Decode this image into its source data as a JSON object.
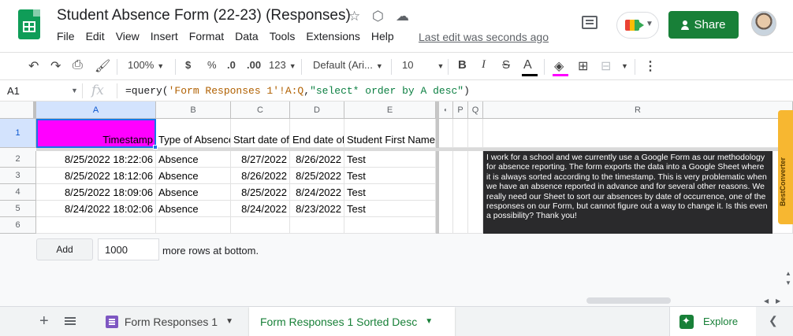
{
  "header": {
    "title": "Student Absence Form (22-23) (Responses)",
    "menu": [
      "File",
      "Edit",
      "View",
      "Insert",
      "Format",
      "Data",
      "Tools",
      "Extensions",
      "Help"
    ],
    "last_edit": "Last edit was seconds ago",
    "share_label": "Share"
  },
  "toolbar": {
    "zoom": "100%",
    "currency": "$",
    "percent": "%",
    "decrease_decimal": ".0",
    "increase_decimal": ".00",
    "more_formats": "123",
    "font": "Default (Ari...",
    "font_size": "10",
    "bold": "B",
    "italic": "I",
    "strike": "S",
    "text_color": "A",
    "fill_color": "#ff00ff",
    "text_color_bar": "#000000"
  },
  "formula_bar": {
    "cell_ref": "A1",
    "fx": "fx",
    "formula_fn": "=query(",
    "formula_arg1": "'Form Responses 1'!A:Q",
    "formula_comma": ",",
    "formula_arg2": "\"select* order by A desc\"",
    "formula_close": ")"
  },
  "grid": {
    "columns": [
      "A",
      "B",
      "C",
      "D",
      "E",
      "",
      "P",
      "Q",
      "R"
    ],
    "rows": [
      "1",
      "2",
      "3",
      "4",
      "5",
      "6"
    ],
    "header_row": [
      "Timestamp",
      "Type of Absence",
      "Start date of",
      "End date of",
      "Student First Name"
    ],
    "data_rows": [
      [
        "8/25/2022 18:22:06",
        "Absence",
        "8/27/2022",
        "8/26/2022",
        "Test"
      ],
      [
        "8/25/2022 18:12:06",
        "Absence",
        "8/26/2022",
        "8/25/2022",
        "Test"
      ],
      [
        "8/25/2022 18:09:06",
        "Absence",
        "8/25/2022",
        "8/24/2022",
        "Test"
      ],
      [
        "8/24/2022 18:02:06",
        "Absence",
        "8/24/2022",
        "8/23/2022",
        "Test"
      ]
    ],
    "a1_fill": "#ff00ff"
  },
  "note": "I work for a school and we currently use a Google Form as our methodology for absence reporting. The form exports the data into a Google Sheet where it is always sorted according to the timestamp. This is very problematic when we have an absence reported in advance and for several other reasons. We really need our Sheet to sort our absences by date of occurrence, one of the responses on our Form, but cannot figure out a way to change it. Is this even a possibility? Thank you!",
  "add_rows": {
    "button": "Add",
    "count": "1000",
    "suffix": "more rows at bottom."
  },
  "sidebar_addon": "BestConverter",
  "tabs": {
    "tab1": "Form Responses 1",
    "tab2": "Form Responses 1 Sorted Desc",
    "explore": "Explore"
  },
  "colors": {
    "brand_green": "#188038",
    "selection_blue": "#1a73e8"
  }
}
